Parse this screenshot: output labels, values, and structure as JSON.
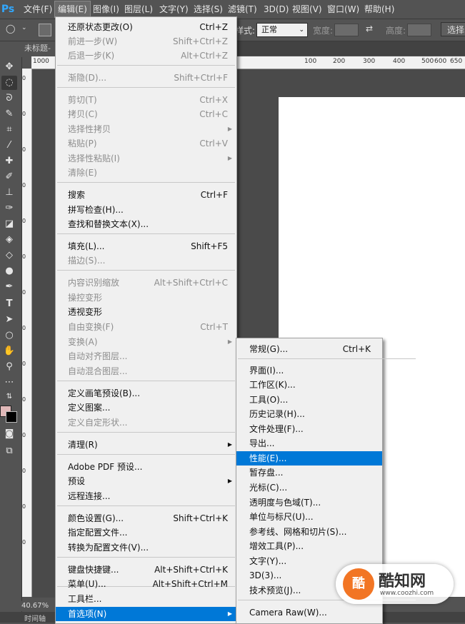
{
  "app": {
    "logo": "Ps"
  },
  "menubar": {
    "items": [
      "文件(F)",
      "编辑(E)",
      "图像(I)",
      "图层(L)",
      "文字(Y)",
      "选择(S)",
      "滤镜(T)",
      "3D(D)",
      "视图(V)",
      "窗口(W)",
      "帮助(H)"
    ],
    "active_index": 1
  },
  "options": {
    "style_label": "样式:",
    "style_value": "正常",
    "width_label": "宽度:",
    "height_label": "高度:",
    "select_button": "选择"
  },
  "document": {
    "tab_label": "未标题-",
    "zoom": "40.67%",
    "timeline_label": "时间轴",
    "ruler_labels": [
      "1000",
      "100",
      "200",
      "300",
      "400",
      "500",
      "600",
      "650"
    ]
  },
  "toolbar": {
    "tools": [
      "move-icon",
      "elliptical-marquee-icon",
      "lasso-icon",
      "quick-select-icon",
      "crop-icon",
      "eyedropper-icon",
      "healing-brush-icon",
      "brush-icon",
      "clone-stamp-icon",
      "history-brush-icon",
      "eraser-icon",
      "paint-bucket-icon",
      "blur-icon",
      "dodge-icon",
      "pen-icon",
      "type-icon",
      "path-select-icon",
      "ellipse-shape-icon",
      "hand-icon",
      "zoom-icon",
      "more-tools-icon"
    ],
    "foreground_color": "#e0b8b8",
    "background_color": "#000000"
  },
  "edit_menu": {
    "items": [
      {
        "label": "还原状态更改(O)",
        "shortcut": "Ctrl+Z",
        "disabled": false
      },
      {
        "label": "前进一步(W)",
        "shortcut": "Shift+Ctrl+Z",
        "disabled": true
      },
      {
        "label": "后退一步(K)",
        "shortcut": "Alt+Ctrl+Z",
        "disabled": true
      },
      {
        "label": "渐隐(D)...",
        "shortcut": "Shift+Ctrl+F",
        "disabled": true
      },
      {
        "label": "剪切(T)",
        "shortcut": "Ctrl+X",
        "disabled": true
      },
      {
        "label": "拷贝(C)",
        "shortcut": "Ctrl+C",
        "disabled": true
      },
      {
        "label": "选择性拷贝",
        "shortcut": "",
        "disabled": true,
        "submenu": true
      },
      {
        "label": "粘贴(P)",
        "shortcut": "Ctrl+V",
        "disabled": true
      },
      {
        "label": "选择性粘贴(I)",
        "shortcut": "",
        "disabled": true,
        "submenu": true
      },
      {
        "label": "清除(E)",
        "shortcut": "",
        "disabled": true
      },
      {
        "label": "搜索",
        "shortcut": "Ctrl+F",
        "disabled": false
      },
      {
        "label": "拼写检查(H)...",
        "shortcut": "",
        "disabled": false
      },
      {
        "label": "查找和替换文本(X)...",
        "shortcut": "",
        "disabled": false
      },
      {
        "label": "填充(L)...",
        "shortcut": "Shift+F5",
        "disabled": false
      },
      {
        "label": "描边(S)...",
        "shortcut": "",
        "disabled": true
      },
      {
        "label": "内容识别缩放",
        "shortcut": "Alt+Shift+Ctrl+C",
        "disabled": true
      },
      {
        "label": "操控变形",
        "shortcut": "",
        "disabled": true
      },
      {
        "label": "透视变形",
        "shortcut": "",
        "disabled": false
      },
      {
        "label": "自由变换(F)",
        "shortcut": "Ctrl+T",
        "disabled": true
      },
      {
        "label": "变换(A)",
        "shortcut": "",
        "disabled": true,
        "submenu": true
      },
      {
        "label": "自动对齐图层...",
        "shortcut": "",
        "disabled": true
      },
      {
        "label": "自动混合图层...",
        "shortcut": "",
        "disabled": true
      },
      {
        "label": "定义画笔预设(B)...",
        "shortcut": "",
        "disabled": false
      },
      {
        "label": "定义图案...",
        "shortcut": "",
        "disabled": false
      },
      {
        "label": "定义自定形状...",
        "shortcut": "",
        "disabled": true
      },
      {
        "label": "清理(R)",
        "shortcut": "",
        "disabled": false,
        "submenu": true
      },
      {
        "label": "Adobe PDF 预设...",
        "shortcut": "",
        "disabled": false
      },
      {
        "label": "预设",
        "shortcut": "",
        "disabled": false,
        "submenu": true
      },
      {
        "label": "远程连接...",
        "shortcut": "",
        "disabled": false
      },
      {
        "label": "颜色设置(G)...",
        "shortcut": "Shift+Ctrl+K",
        "disabled": false
      },
      {
        "label": "指定配置文件...",
        "shortcut": "",
        "disabled": false
      },
      {
        "label": "转换为配置文件(V)...",
        "shortcut": "",
        "disabled": false
      },
      {
        "label": "键盘快捷键...",
        "shortcut": "Alt+Shift+Ctrl+K",
        "disabled": false
      },
      {
        "label": "菜单(U)...",
        "shortcut": "Alt+Shift+Ctrl+M",
        "disabled": false
      },
      {
        "label": "工具栏...",
        "shortcut": "",
        "disabled": false
      },
      {
        "label": "首选项(N)",
        "shortcut": "",
        "disabled": false,
        "submenu": true,
        "highlighted": true
      }
    ]
  },
  "preferences_submenu": {
    "items": [
      {
        "label": "常规(G)...",
        "shortcut": "Ctrl+K"
      },
      {
        "label": "界面(I)...",
        "shortcut": ""
      },
      {
        "label": "工作区(K)...",
        "shortcut": ""
      },
      {
        "label": "工具(O)...",
        "shortcut": ""
      },
      {
        "label": "历史记录(H)...",
        "shortcut": ""
      },
      {
        "label": "文件处理(F)...",
        "shortcut": ""
      },
      {
        "label": "导出...",
        "shortcut": ""
      },
      {
        "label": "性能(E)...",
        "shortcut": "",
        "highlighted": true
      },
      {
        "label": "暂存盘...",
        "shortcut": ""
      },
      {
        "label": "光标(C)...",
        "shortcut": ""
      },
      {
        "label": "透明度与色域(T)...",
        "shortcut": ""
      },
      {
        "label": "单位与标尺(U)...",
        "shortcut": ""
      },
      {
        "label": "参考线、网格和切片(S)...",
        "shortcut": ""
      },
      {
        "label": "增效工具(P)...",
        "shortcut": ""
      },
      {
        "label": "文字(Y)...",
        "shortcut": ""
      },
      {
        "label": "3D(3)...",
        "shortcut": ""
      },
      {
        "label": "技术预览(J)...",
        "shortcut": ""
      },
      {
        "label": "Camera Raw(W)...",
        "shortcut": ""
      }
    ]
  },
  "watermark": {
    "logo_text": "酷",
    "name": "酷知网",
    "url": "www.coozhi.com"
  },
  "colors": {
    "highlight": "#0078d7",
    "menu_bg": "#f0f0f0",
    "ps_blue": "#31a8ff"
  }
}
